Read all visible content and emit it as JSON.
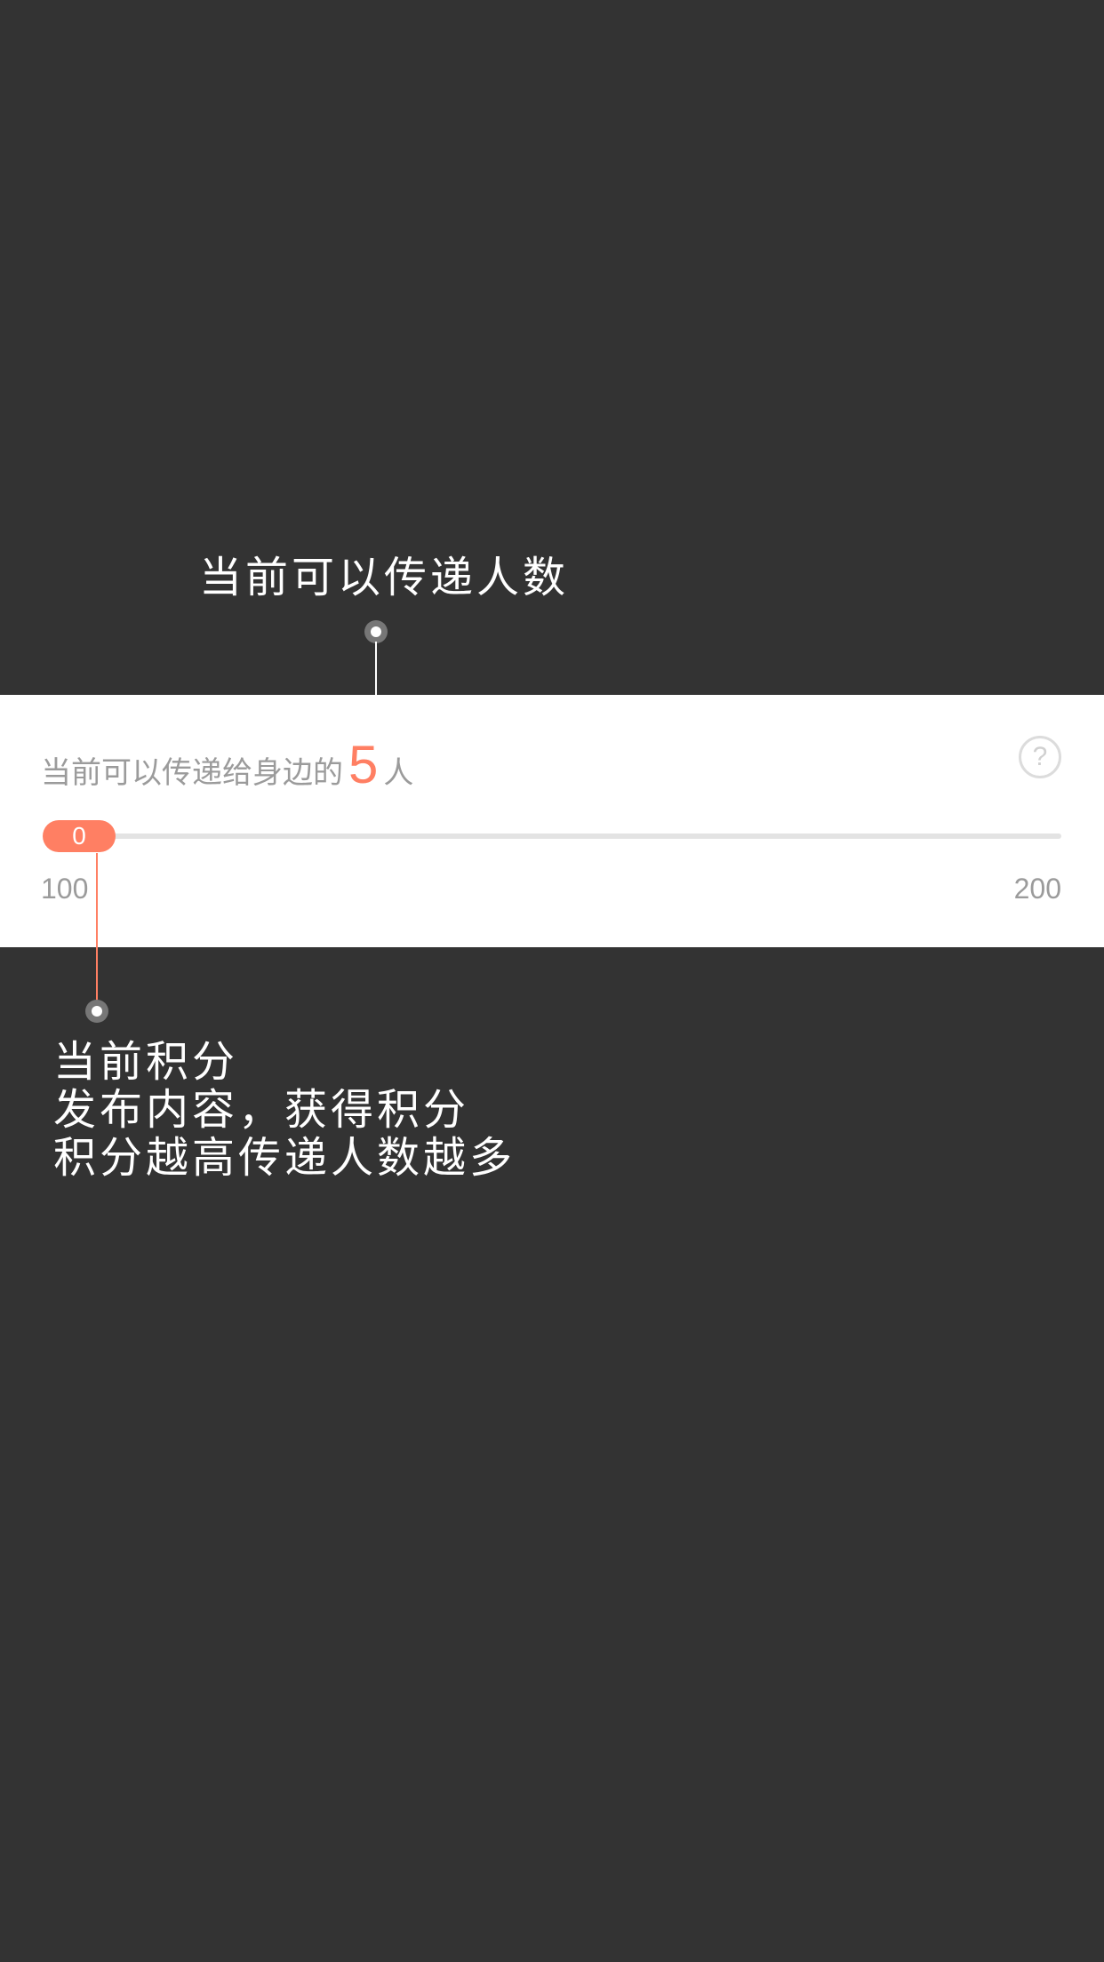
{
  "annotations": {
    "top_label": "当前可以传递人数",
    "bottom_lines": [
      "当前积分",
      "发布内容，获得积分",
      "积分越高传递人数越多"
    ]
  },
  "card": {
    "prefix": "当前可以传递给身边的",
    "count": "5",
    "suffix": "人",
    "help_icon_glyph": "?",
    "slider": {
      "thumb_label": "0",
      "min_label": "100",
      "max_label": "200",
      "progress_fraction": 0
    }
  },
  "colors": {
    "background": "#333333",
    "card": "#ffffff",
    "accent": "#ff7f63",
    "muted_text": "#9b9b9b",
    "track": "#e3e3e3"
  },
  "icons": {
    "help": "question-circle-icon",
    "annotation_pin": "pin-dot-icon"
  }
}
